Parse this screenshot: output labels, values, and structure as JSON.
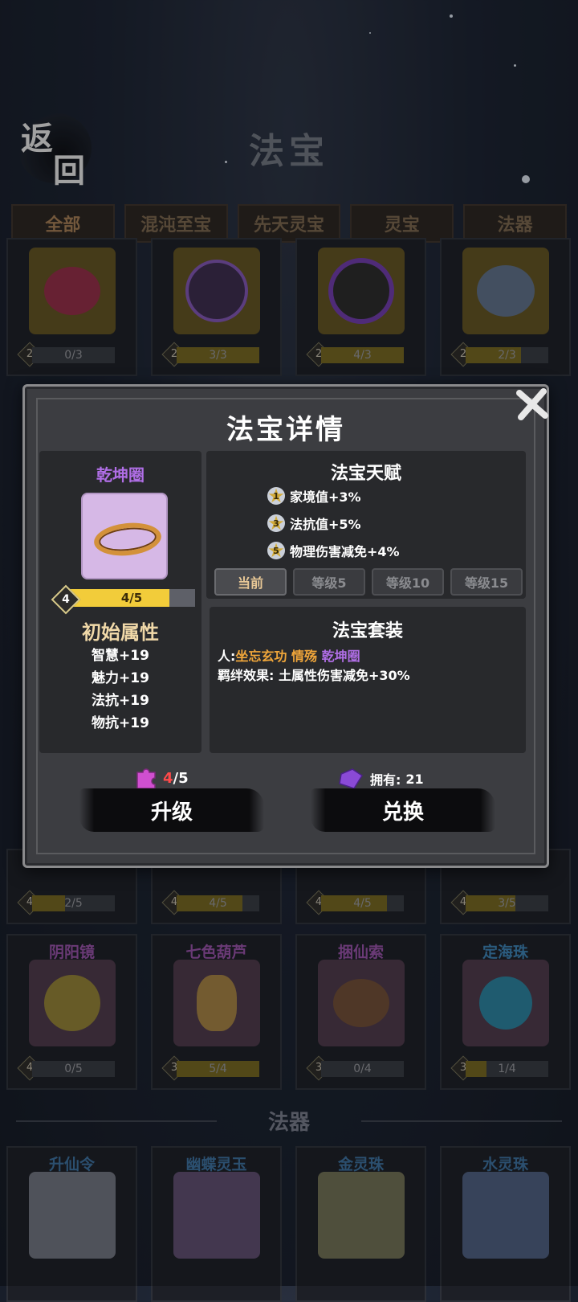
{
  "header": {
    "back_char_1": "返",
    "back_char_2": "回",
    "title": "法宝"
  },
  "tabs": [
    "全部",
    "混沌至宝",
    "先天灵宝",
    "灵宝",
    "法器"
  ],
  "active_tab": 0,
  "grid_top": [
    {
      "level": "2",
      "progress": "0/3",
      "fill": 0.0,
      "color": "#c0385a"
    },
    {
      "level": "2",
      "progress": "3/3",
      "fill": 1.0,
      "color": "#7a52a8"
    },
    {
      "level": "2",
      "progress": "4/3",
      "fill": 1.0,
      "color": "#6a3aa0"
    },
    {
      "level": "2",
      "progress": "2/3",
      "fill": 0.67,
      "color": "#9ab0c8"
    }
  ],
  "grid_mid": [
    {
      "level": "4",
      "progress": "2/5",
      "fill": 0.4
    },
    {
      "level": "4",
      "progress": "4/5",
      "fill": 0.8
    },
    {
      "level": "4",
      "progress": "4/5",
      "fill": 0.8
    },
    {
      "level": "4",
      "progress": "3/5",
      "fill": 0.6
    }
  ],
  "grid_bottom": [
    {
      "name": "阴阳镜",
      "level": "4",
      "progress": "0/5",
      "fill": 0.0,
      "color": "#d8b24a"
    },
    {
      "name": "七色葫芦",
      "level": "3",
      "progress": "5/4",
      "fill": 1.0,
      "color": "#e0a850"
    },
    {
      "name": "捆仙索",
      "level": "3",
      "progress": "0/4",
      "fill": 0.0,
      "color": "#a06a4a"
    },
    {
      "name": "定海珠",
      "level": "3",
      "progress": "1/4",
      "fill": 0.25,
      "color": "#3aa8c8"
    }
  ],
  "section_faqi": {
    "title": "法器"
  },
  "grid_faqi": [
    {
      "name": "升仙令"
    },
    {
      "name": "幽蝶灵玉"
    },
    {
      "name": "金灵珠"
    },
    {
      "name": "水灵珠"
    }
  ],
  "modal": {
    "title": "法宝详情",
    "item": {
      "name": "乾坤圈",
      "level": "4",
      "progress": "4/5",
      "fill": 0.8
    },
    "initial_attributes": {
      "title": "初始属性",
      "items": [
        "智慧+19",
        "魅力+19",
        "法抗+19",
        "物抗+19"
      ]
    },
    "talent": {
      "title": "法宝天赋",
      "items": [
        {
          "star": "1",
          "text": "家境值+3%"
        },
        {
          "star": "3",
          "text": "法抗值+5%"
        },
        {
          "star": "5",
          "text": "物理伤害减免+4%"
        }
      ],
      "level_tabs": [
        "当前",
        "等级5",
        "等级10",
        "等级15"
      ],
      "active_level_tab": 0
    },
    "set": {
      "title": "法宝套装",
      "line1_prefix": "人:",
      "line1_items_yellow": "坐忘玄功 情殇",
      "line1_item_purple": "乾坤圈",
      "line2": "羁绊效果: 土属性伤害减免+30%"
    },
    "fragments": {
      "current": "4",
      "total": "/5"
    },
    "owned": {
      "label": "拥有:",
      "value": "21"
    },
    "upgrade_label": "升级",
    "exchange_label": "兑换"
  }
}
